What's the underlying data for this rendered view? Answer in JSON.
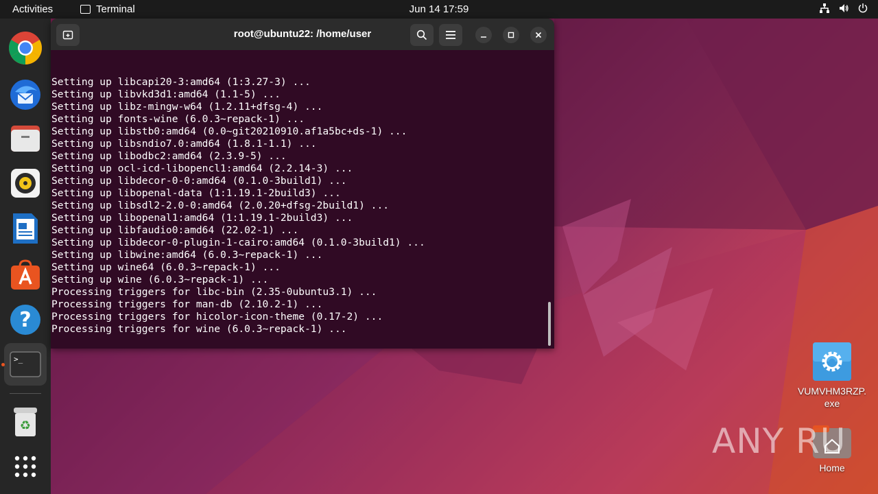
{
  "topbar": {
    "activities": "Activities",
    "app_name": "Terminal",
    "clock": "Jun 14  17:59",
    "tray_icons": [
      "network-icon",
      "volume-icon",
      "power-icon"
    ]
  },
  "dock": {
    "items": [
      {
        "name": "google-chrome",
        "icon": "chrome-icon"
      },
      {
        "name": "thunderbird",
        "icon": "thunderbird-icon"
      },
      {
        "name": "files",
        "icon": "files-icon"
      },
      {
        "name": "rhythmbox",
        "icon": "rhythmbox-icon"
      },
      {
        "name": "libreoffice-writer",
        "icon": "writer-icon"
      },
      {
        "name": "ubuntu-software",
        "icon": "software-icon"
      },
      {
        "name": "help",
        "icon": "help-icon"
      },
      {
        "name": "terminal",
        "icon": "terminal-icon",
        "running": true
      },
      {
        "name": "trash",
        "icon": "trash-icon"
      },
      {
        "name": "show-applications",
        "icon": "app-grid-icon"
      }
    ]
  },
  "terminal": {
    "title": "root@ubuntu22: /home/user",
    "prompt_glyph": ">_",
    "lines": [
      "Setting up libcapi20-3:amd64 (1:3.27-3) ...",
      "Setting up libvkd3d1:amd64 (1.1-5) ...",
      "Setting up libz-mingw-w64 (1.2.11+dfsg-4) ...",
      "Setting up fonts-wine (6.0.3~repack-1) ...",
      "Setting up libstb0:amd64 (0.0~git20210910.af1a5bc+ds-1) ...",
      "Setting up libsndio7.0:amd64 (1.8.1-1.1) ...",
      "Setting up libodbc2:amd64 (2.3.9-5) ...",
      "Setting up ocl-icd-libopencl1:amd64 (2.2.14-3) ...",
      "Setting up libdecor-0-0:amd64 (0.1.0-3build1) ...",
      "Setting up libopenal-data (1:1.19.1-2build3) ...",
      "Setting up libsdl2-2.0-0:amd64 (2.0.20+dfsg-2build1) ...",
      "Setting up libopenal1:amd64 (1:1.19.1-2build3) ...",
      "Setting up libfaudio0:amd64 (22.02-1) ...",
      "Setting up libdecor-0-plugin-1-cairo:amd64 (0.1.0-3build1) ...",
      "Setting up libwine:amd64 (6.0.3~repack-1) ...",
      "Setting up wine64 (6.0.3~repack-1) ...",
      "Setting up wine (6.0.3~repack-1) ...",
      "Processing triggers for libc-bin (2.35-0ubuntu3.1) ...",
      "Processing triggers for man-db (2.10.2-1) ...",
      "Processing triggers for hicolor-icon-theme (0.17-2) ...",
      "Processing triggers for wine (6.0.3~repack-1) ..."
    ]
  },
  "desktop": {
    "icons": [
      {
        "label": "VUMVHM3RZP.\nexe",
        "icon": "gear-icon"
      },
      {
        "label": "Home",
        "icon": "home-folder-icon"
      }
    ],
    "watermark": "ANY RUN"
  },
  "colors": {
    "terminal_bg": "#300a24",
    "titlebar_bg": "#2c2c2c",
    "dock_bg": "#262626",
    "accent": "#e95420"
  }
}
